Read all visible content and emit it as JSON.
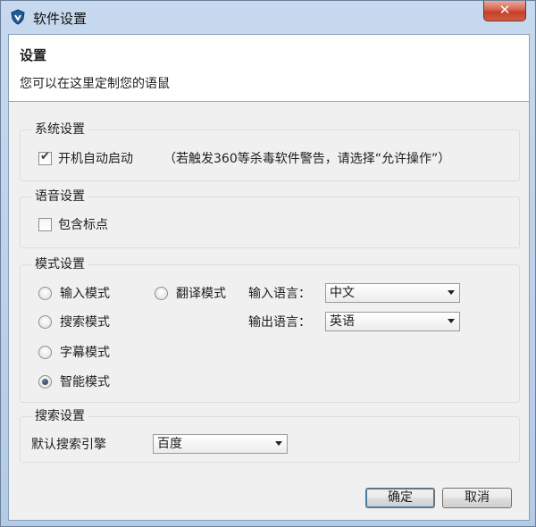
{
  "window": {
    "title": "软件设置",
    "close_label": "✕"
  },
  "header": {
    "title": "设置",
    "description": "您可以在这里定制您的语鼠"
  },
  "system_settings": {
    "title": "系统设置",
    "autostart_label": "开机自动启动",
    "autostart_checked": true,
    "autostart_note": "（若触发360等杀毒软件警告，请选择“允许操作”）"
  },
  "voice_settings": {
    "title": "语音设置",
    "punctuation_label": "包含标点",
    "punctuation_checked": false
  },
  "mode_settings": {
    "title": "模式设置",
    "modes": [
      {
        "label": "输入模式",
        "selected": false
      },
      {
        "label": "翻译模式",
        "selected": false
      },
      {
        "label": "搜索模式",
        "selected": false
      },
      {
        "label": "字幕模式",
        "selected": false
      },
      {
        "label": "智能模式",
        "selected": true
      }
    ],
    "input_language_label": "输入语言：",
    "input_language_value": "中文",
    "output_language_label": "输出语言：",
    "output_language_value": "英语"
  },
  "search_settings": {
    "title": "搜索设置",
    "engine_label": "默认搜索引擎",
    "engine_value": "百度"
  },
  "buttons": {
    "ok": "确定",
    "cancel": "取消"
  }
}
